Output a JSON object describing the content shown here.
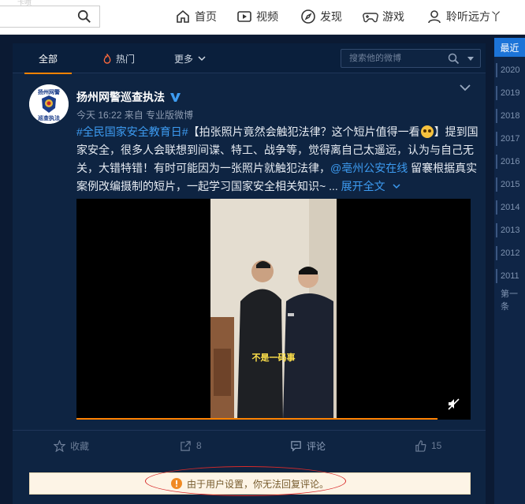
{
  "nav": {
    "faint_text": "卡喷",
    "items": [
      {
        "label": "首页",
        "icon": "home-icon"
      },
      {
        "label": "视频",
        "icon": "video-icon"
      },
      {
        "label": "发现",
        "icon": "compass-icon"
      },
      {
        "label": "游戏",
        "icon": "gamepad-icon"
      },
      {
        "label": "聆听远方丫",
        "icon": "user-icon"
      }
    ]
  },
  "tabs": {
    "all": "全部",
    "hot": "热门",
    "more": "更多",
    "search_placeholder": "搜索他的微博"
  },
  "post": {
    "author": "扬州网警巡查执法",
    "avatar_text": "扬州网警",
    "avatar_sub": "巡查执法",
    "time": "今天 16:22",
    "source": "来自 专业版微博",
    "hashtag": "#全民国家安全教育日#",
    "text_a": "【拍张照片竟然会触犯法律？这个短片值得一看",
    "text_b": "】提到国家安全，很多人会联想到间谍、特工、战争等，觉得离自己太遥远，认为与自己无关，大错特错！有时可能因为一张照片就触犯法律，",
    "mention": "@亳州公安在线",
    "text_c": " 留褰根据真实案例改编摄制的短片，一起学习国家安全相关知识~ ...",
    "expand": "展开全文",
    "video_caption": "不是一码事",
    "video_progress": 0.916
  },
  "actions": {
    "favorite": "收藏",
    "forward": "8",
    "comment": "评论",
    "like": "15"
  },
  "notice": "由于用户设置，你无法回复评论。",
  "timeline": {
    "latest": "最近",
    "years": [
      "2020",
      "2019",
      "2018",
      "2017",
      "2016",
      "2015",
      "2014",
      "2013",
      "2012",
      "2011"
    ],
    "first": "第一条"
  },
  "colors": {
    "accent": "#ff8200",
    "link": "#3d9cf2",
    "annotation": "#d82a2a"
  }
}
